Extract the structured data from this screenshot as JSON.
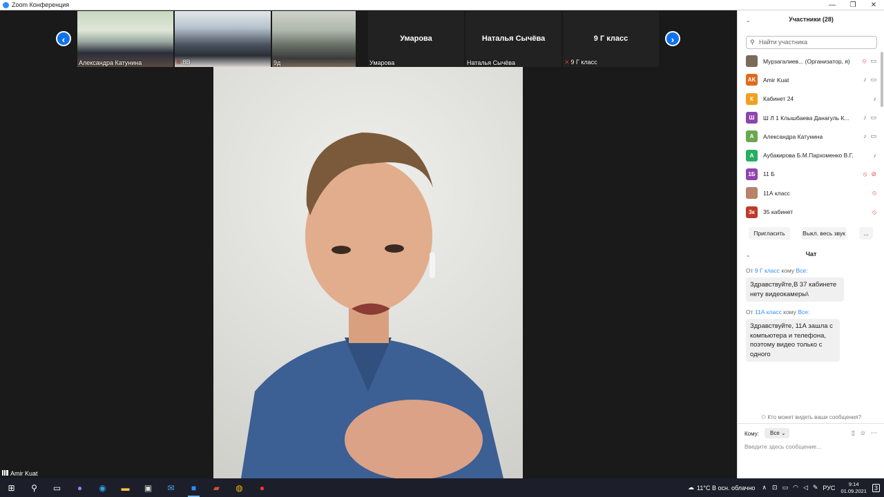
{
  "window": {
    "title": "Zoom Конференция",
    "buttons": [
      "—",
      "❐",
      "✕"
    ]
  },
  "strip": {
    "thumbs": [
      {
        "label": "Александра Катунина",
        "extra": "",
        "muted": false,
        "style": "classroom1"
      },
      {
        "label": "8В",
        "extra": "",
        "muted": true,
        "style": "classroom2"
      },
      {
        "label": "",
        "extra": "9д",
        "muted": false,
        "style": "classroom3"
      },
      {
        "bigname": "Умарова",
        "label": "Умарова",
        "muted": false
      },
      {
        "bigname": "Наталья Сычёва",
        "label": "Наталья Сычёва",
        "muted": false
      },
      {
        "bigname": "9 Г класс",
        "label": "9 Г класс",
        "muted": true
      }
    ],
    "prev": "‹",
    "next": "›"
  },
  "speaker": {
    "name": "Amir Kuat"
  },
  "participants": {
    "title": "Участники (28)",
    "search_placeholder": "Найти участника",
    "items": [
      {
        "initials": "",
        "color": "#7a6a5a",
        "name": "Мурзагалиев... (Организатор, я)",
        "mic": "off",
        "video": "on"
      },
      {
        "initials": "AK",
        "color": "#e06a1b",
        "name": "Amir Kuat",
        "mic": "on",
        "video": "on"
      },
      {
        "initials": "К",
        "color": "#f0a020",
        "name": "Кабинет 24",
        "mic": "on",
        "video": "none"
      },
      {
        "initials": "Ш",
        "color": "#8e44ad",
        "name": "Ш Л 1 Клышбаева Данагуль К...",
        "mic": "on",
        "video": "on"
      },
      {
        "initials": "А",
        "color": "#6aa84f",
        "name": "Александра Катунина",
        "mic": "on",
        "video": "on"
      },
      {
        "initials": "А",
        "color": "#27ae60",
        "name": "Аубакирова Б.М.Пархоменко В.Г.",
        "mic": "on",
        "video": "none"
      },
      {
        "initials": "1Б",
        "color": "#8e44ad",
        "name": "11 Б",
        "mic": "off",
        "video": "off"
      },
      {
        "initials": "",
        "color": "#b9826a",
        "name": "11А класс",
        "mic": "off",
        "video": "none"
      },
      {
        "initials": "3к",
        "color": "#c0392b",
        "name": "35 кабинет",
        "mic": "off",
        "video": "none"
      }
    ],
    "invite": "Пригласить",
    "mute_all": "Выкл. весь звук",
    "more": "..."
  },
  "chat": {
    "title": "Чат",
    "messages": [
      {
        "from_prefix": "От",
        "from": "9 Г класс",
        "to_prefix": "кому",
        "to": "Все:",
        "lines": [
          "Здравствуйте,В 37 кабинете",
          "нету видеокамеры\\"
        ]
      },
      {
        "from_prefix": "От",
        "from": "11А класс",
        "to_prefix": "кому",
        "to": "Все:",
        "lines": [
          "Здравствуйте, 11А зашла с",
          "компьютера и телефона,",
          "поэтому видео только с",
          "одного"
        ]
      }
    ],
    "who_can_see": "Кто может видеть ваши сообщения?",
    "to_label": "Кому:",
    "to_value": "Все",
    "input_placeholder": "Введите здесь сообщение..."
  },
  "taskbar": {
    "weather": "11°C  В осн. облачно",
    "lang": "РУС",
    "time": "9:14",
    "date": "01.09.2021",
    "notif": "3"
  }
}
